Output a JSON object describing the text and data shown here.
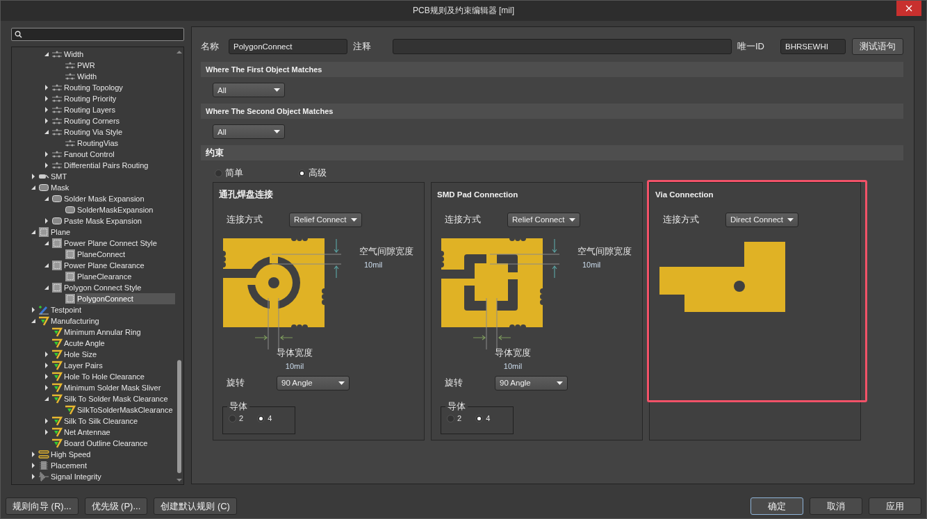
{
  "window": {
    "title": "PCB规则及约束编辑器 [mil]"
  },
  "tree": {
    "items": [
      {
        "children": [
          {
            "label": "Width",
            "kind": "routing",
            "expanded": true,
            "selected": false,
            "children": [
              {
                "label": "PWR",
                "kind": "routing",
                "selected": false
              },
              {
                "label": "Width",
                "kind": "routing",
                "selected": false
              }
            ]
          },
          {
            "label": "Routing Topology",
            "kind": "routing",
            "expanded": false,
            "selected": false
          },
          {
            "label": "Routing Priority",
            "kind": "routing",
            "expanded": false,
            "selected": false
          },
          {
            "label": "Routing Layers",
            "kind": "routing",
            "expanded": false,
            "selected": false
          },
          {
            "label": "Routing Corners",
            "kind": "routing",
            "expanded": false,
            "selected": false
          },
          {
            "label": "Routing Via Style",
            "kind": "routing",
            "expanded": true,
            "selected": false,
            "children": [
              {
                "label": "RoutingVias",
                "kind": "routing",
                "selected": false
              }
            ]
          },
          {
            "label": "Fanout Control",
            "kind": "routing",
            "expanded": false,
            "selected": false
          },
          {
            "label": "Differential Pairs Routing",
            "kind": "routing",
            "expanded": false,
            "selected": false
          }
        ]
      },
      {
        "label": "SMT",
        "kind": "smt",
        "expanded": false,
        "selected": false
      },
      {
        "label": "Mask",
        "kind": "mask",
        "expanded": true,
        "selected": false,
        "children": [
          {
            "label": "Solder Mask Expansion",
            "kind": "mask",
            "expanded": true,
            "selected": false,
            "children": [
              {
                "label": "SolderMaskExpansion",
                "kind": "mask",
                "selected": false
              }
            ]
          },
          {
            "label": "Paste Mask Expansion",
            "kind": "mask",
            "expanded": false,
            "selected": false
          }
        ]
      },
      {
        "label": "Plane",
        "kind": "plane",
        "expanded": true,
        "selected": false,
        "children": [
          {
            "label": "Power Plane Connect Style",
            "kind": "plane",
            "expanded": true,
            "selected": false,
            "children": [
              {
                "label": "PlaneConnect",
                "kind": "plane",
                "selected": false
              }
            ]
          },
          {
            "label": "Power Plane Clearance",
            "kind": "plane",
            "expanded": true,
            "selected": false,
            "children": [
              {
                "label": "PlaneClearance",
                "kind": "plane",
                "selected": false
              }
            ]
          },
          {
            "label": "Polygon Connect Style",
            "kind": "plane",
            "expanded": true,
            "selected": false,
            "children": [
              {
                "label": "PolygonConnect",
                "kind": "plane",
                "selected": true
              }
            ]
          }
        ]
      },
      {
        "label": "Testpoint",
        "kind": "testpoint",
        "expanded": false,
        "selected": false
      },
      {
        "label": "Manufacturing",
        "kind": "manufacturing",
        "expanded": true,
        "selected": false,
        "children": [
          {
            "label": "Minimum Annular Ring",
            "kind": "manufacturing",
            "selected": false
          },
          {
            "label": "Acute Angle",
            "kind": "manufacturing",
            "selected": false
          },
          {
            "label": "Hole Size",
            "kind": "manufacturing",
            "expanded": false,
            "selected": false
          },
          {
            "label": "Layer Pairs",
            "kind": "manufacturing",
            "expanded": false,
            "selected": false
          },
          {
            "label": "Hole To Hole Clearance",
            "kind": "manufacturing",
            "expanded": false,
            "selected": false
          },
          {
            "label": "Minimum Solder Mask Sliver",
            "kind": "manufacturing",
            "expanded": false,
            "selected": false
          },
          {
            "label": "Silk To Solder Mask Clearance",
            "kind": "manufacturing",
            "expanded": true,
            "selected": false,
            "children": [
              {
                "label": "SilkToSolderMaskClearance",
                "kind": "manufacturing",
                "selected": false
              }
            ]
          },
          {
            "label": "Silk To Silk Clearance",
            "kind": "manufacturing",
            "expanded": false,
            "selected": false
          },
          {
            "label": "Net Antennae",
            "kind": "manufacturing",
            "expanded": false,
            "selected": false
          },
          {
            "label": "Board Outline Clearance",
            "kind": "manufacturing",
            "selected": false
          }
        ]
      },
      {
        "label": "High Speed",
        "kind": "highspeed",
        "expanded": false,
        "selected": false
      },
      {
        "label": "Placement",
        "kind": "placement",
        "expanded": false,
        "selected": false
      },
      {
        "label": "Signal Integrity",
        "kind": "signal",
        "expanded": false,
        "selected": false
      }
    ]
  },
  "rule": {
    "name_label": "名称",
    "name_value": "PolygonConnect",
    "comment_label": "注释",
    "id_label": "唯一ID",
    "id_value": "BHRSEWHI",
    "test_button": "测试语句"
  },
  "first_match": {
    "title": "Where The First Object Matches",
    "value": "All"
  },
  "second_match": {
    "title": "Where The Second Object Matches",
    "value": "All"
  },
  "constraints": {
    "title": "约束",
    "modes": [
      {
        "label": "简单",
        "selected": false
      },
      {
        "label": "高级",
        "selected": true
      }
    ],
    "cards": [
      {
        "kind": "thermal_round",
        "title": "通孔焊盘连接",
        "connect_label": "连接方式",
        "connect_value": "Relief Connect",
        "air_gap_label": "空气间隙宽度",
        "air_gap_value": "10mil",
        "conductor_width_label": "导体宽度",
        "conductor_width_value": "10mil",
        "rotation_label": "旋转",
        "rotation_value": "90 Angle",
        "conductors": {
          "label": "导体",
          "options": [
            {
              "label": "2",
              "selected": false
            },
            {
              "label": "4",
              "selected": true
            }
          ]
        }
      },
      {
        "kind": "thermal_square",
        "title": "SMD Pad Connection",
        "connect_label": "连接方式",
        "connect_value": "Relief Connect",
        "air_gap_label": "空气间隙宽度",
        "air_gap_value": "10mil",
        "conductor_width_label": "导体宽度",
        "conductor_width_value": "10mil",
        "rotation_label": "旋转",
        "rotation_value": "90 Angle",
        "conductors": {
          "label": "导体",
          "options": [
            {
              "label": "2",
              "selected": false
            },
            {
              "label": "4",
              "selected": true
            }
          ]
        }
      },
      {
        "kind": "direct",
        "title": "Via Connection",
        "connect_label": "连接方式",
        "connect_value": "Direct Connect"
      }
    ]
  },
  "footer": {
    "left_buttons": [
      "规则向导 (R)...",
      "优先级 (P)...",
      "创建默认规则 (C)"
    ],
    "right_buttons": [
      {
        "label": "确定",
        "default": true
      },
      {
        "label": "取消",
        "default": false
      },
      {
        "label": "应用",
        "default": false
      }
    ]
  }
}
